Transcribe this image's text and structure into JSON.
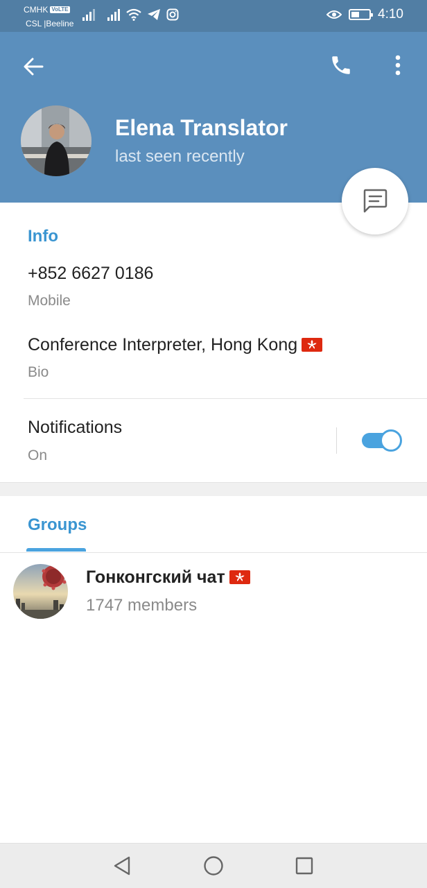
{
  "status_bar": {
    "carrier_1": "CMHK",
    "volte_badge": "VoLTE",
    "carrier_2": "CSL |Beeline",
    "time": "4:10",
    "battery_level": 0.45
  },
  "header": {
    "name": "Elena Translator",
    "status": "last seen recently",
    "background_color": "#5b8fbd"
  },
  "info": {
    "section_title": "Info",
    "phone": "+852 6627 0186",
    "phone_label": "Mobile",
    "bio": "Conference Interpreter, Hong Kong",
    "bio_label": "Bio",
    "notifications_title": "Notifications",
    "notifications_value": "On",
    "notifications_enabled": true
  },
  "groups": {
    "section_title": "Groups",
    "items": [
      {
        "name": "Гонконгский чат",
        "members": "1747 members"
      }
    ]
  },
  "colors": {
    "accent": "#3a95d1",
    "toggle_on": "#4aa3df",
    "status_bar": "#517ea4"
  },
  "icons": {
    "back": "arrow-left-icon",
    "call": "phone-icon",
    "more": "more-vertical-icon",
    "message": "message-icon"
  }
}
